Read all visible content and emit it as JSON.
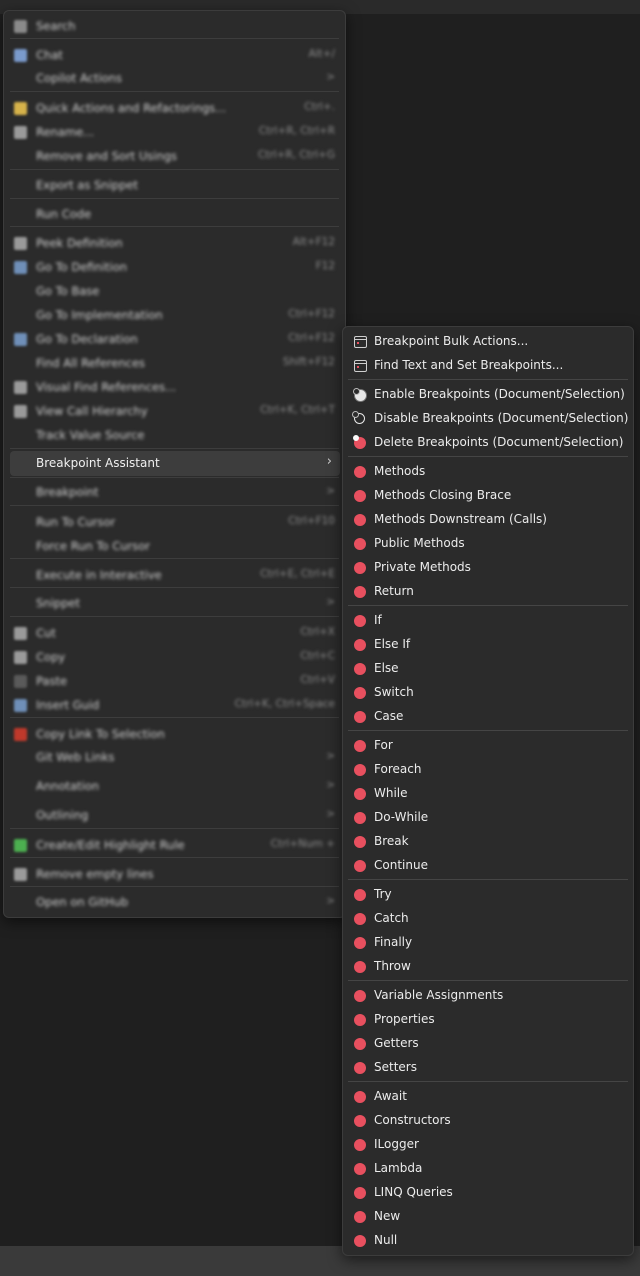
{
  "main_menu": {
    "items": [
      {
        "label": "Search",
        "shortcut": "",
        "icon_color": "#8a8a8a"
      },
      {
        "label": "Chat",
        "shortcut": "Alt+/",
        "icon_color": "#7a9acc"
      },
      {
        "label": "Copilot Actions",
        "shortcut": ">",
        "icon_color": ""
      },
      {
        "label": "Quick Actions and Refactorings...",
        "shortcut": "Ctrl+.",
        "icon_color": "#d6b24a"
      },
      {
        "label": "Rename...",
        "shortcut": "Ctrl+R, Ctrl+R",
        "icon_color": "#9a9a9a"
      },
      {
        "label": "Remove and Sort Usings",
        "shortcut": "Ctrl+R, Ctrl+G",
        "icon_color": ""
      },
      {
        "label": "Export as Snippet",
        "shortcut": "",
        "icon_color": ""
      },
      {
        "label": "Run Code",
        "shortcut": "",
        "icon_color": ""
      },
      {
        "label": "Peek Definition",
        "shortcut": "Alt+F12",
        "icon_color": "#9a9a9a"
      },
      {
        "label": "Go To Definition",
        "shortcut": "F12",
        "icon_color": "#6f8fb8"
      },
      {
        "label": "Go To Base",
        "shortcut": "",
        "icon_color": ""
      },
      {
        "label": "Go To Implementation",
        "shortcut": "Ctrl+F12",
        "icon_color": ""
      },
      {
        "label": "Go To Declaration",
        "shortcut": "Ctrl+F12",
        "icon_color": "#6f8fb8"
      },
      {
        "label": "Find All References",
        "shortcut": "Shift+F12",
        "icon_color": ""
      },
      {
        "label": "Visual Find References...",
        "shortcut": "",
        "icon_color": "#9a9a9a"
      },
      {
        "label": "View Call Hierarchy",
        "shortcut": "Ctrl+K, Ctrl+T",
        "icon_color": "#9a9a9a"
      },
      {
        "label": "Track Value Source",
        "shortcut": "",
        "icon_color": ""
      },
      {
        "label": "Breakpoint",
        "shortcut": ">",
        "icon_color": ""
      },
      {
        "label": "Run To Cursor",
        "shortcut": "Ctrl+F10",
        "icon_color": ""
      },
      {
        "label": "Force Run To Cursor",
        "shortcut": "",
        "icon_color": ""
      },
      {
        "label": "Execute in Interactive",
        "shortcut": "Ctrl+E, Ctrl+E",
        "icon_color": ""
      },
      {
        "label": "Snippet",
        "shortcut": ">",
        "icon_color": ""
      },
      {
        "label": "Cut",
        "shortcut": "Ctrl+X",
        "icon_color": "#9a9a9a"
      },
      {
        "label": "Copy",
        "shortcut": "Ctrl+C",
        "icon_color": "#9a9a9a"
      },
      {
        "label": "Paste",
        "shortcut": "Ctrl+V",
        "icon_color": "#5a5a5a"
      },
      {
        "label": "Insert Guid",
        "shortcut": "Ctrl+K, Ctrl+Space",
        "icon_color": "#6f8fb8"
      },
      {
        "label": "Copy Link To Selection",
        "shortcut": "",
        "icon_color": "#c0392b"
      },
      {
        "label": "Git Web Links",
        "shortcut": ">",
        "icon_color": ""
      },
      {
        "label": "Annotation",
        "shortcut": ">",
        "icon_color": ""
      },
      {
        "label": "Outlining",
        "shortcut": ">",
        "icon_color": ""
      },
      {
        "label": "Create/Edit Highlight Rule",
        "shortcut": "Ctrl+Num +",
        "icon_color": "#4caf50"
      },
      {
        "label": "Remove empty lines",
        "shortcut": "",
        "icon_color": "#9a9a9a"
      },
      {
        "label": "Open on GitHub",
        "shortcut": ">",
        "icon_color": ""
      }
    ],
    "highlighted": {
      "label": "Breakpoint Assistant",
      "arrow": "›"
    }
  },
  "sub_menu": {
    "groups": [
      [
        {
          "label": "Breakpoint Bulk Actions...",
          "icon": "window-icon"
        },
        {
          "label": "Find Text and Set Breakpoints...",
          "icon": "window-icon"
        }
      ],
      [
        {
          "label": "Enable Breakpoints (Document/Selection)",
          "icon": "enable-icon"
        },
        {
          "label": "Disable Breakpoints (Document/Selection)",
          "icon": "disable-icon"
        },
        {
          "label": "Delete Breakpoints (Document/Selection)",
          "icon": "delete-icon"
        }
      ],
      [
        {
          "label": "Methods",
          "icon": "breakpoint-icon"
        },
        {
          "label": "Methods Closing Brace",
          "icon": "breakpoint-icon"
        },
        {
          "label": "Methods Downstream (Calls)",
          "icon": "breakpoint-icon"
        },
        {
          "label": "Public Methods",
          "icon": "breakpoint-icon"
        },
        {
          "label": "Private Methods",
          "icon": "breakpoint-icon"
        },
        {
          "label": "Return",
          "icon": "breakpoint-icon"
        }
      ],
      [
        {
          "label": "If",
          "icon": "breakpoint-icon"
        },
        {
          "label": "Else If",
          "icon": "breakpoint-icon"
        },
        {
          "label": "Else",
          "icon": "breakpoint-icon"
        },
        {
          "label": "Switch",
          "icon": "breakpoint-icon"
        },
        {
          "label": "Case",
          "icon": "breakpoint-icon"
        }
      ],
      [
        {
          "label": "For",
          "icon": "breakpoint-icon"
        },
        {
          "label": "Foreach",
          "icon": "breakpoint-icon"
        },
        {
          "label": "While",
          "icon": "breakpoint-icon"
        },
        {
          "label": "Do-While",
          "icon": "breakpoint-icon"
        },
        {
          "label": "Break",
          "icon": "breakpoint-icon"
        },
        {
          "label": "Continue",
          "icon": "breakpoint-icon"
        }
      ],
      [
        {
          "label": "Try",
          "icon": "breakpoint-icon"
        },
        {
          "label": "Catch",
          "icon": "breakpoint-icon"
        },
        {
          "label": "Finally",
          "icon": "breakpoint-icon"
        },
        {
          "label": "Throw",
          "icon": "breakpoint-icon"
        }
      ],
      [
        {
          "label": "Variable Assignments",
          "icon": "breakpoint-icon"
        },
        {
          "label": "Properties",
          "icon": "breakpoint-icon"
        },
        {
          "label": "Getters",
          "icon": "breakpoint-icon"
        },
        {
          "label": "Setters",
          "icon": "breakpoint-icon"
        }
      ],
      [
        {
          "label": "Await",
          "icon": "breakpoint-icon"
        },
        {
          "label": "Constructors",
          "icon": "breakpoint-icon"
        },
        {
          "label": "ILogger",
          "icon": "breakpoint-icon"
        },
        {
          "label": "Lambda",
          "icon": "breakpoint-icon"
        },
        {
          "label": "LINQ Queries",
          "icon": "breakpoint-icon"
        },
        {
          "label": "New",
          "icon": "breakpoint-icon"
        },
        {
          "label": "Null",
          "icon": "breakpoint-icon"
        }
      ]
    ]
  },
  "colors": {
    "breakpoint": "#e8505f",
    "menu_bg": "#2b2b2b",
    "highlight_bg": "#3d3d3d"
  }
}
